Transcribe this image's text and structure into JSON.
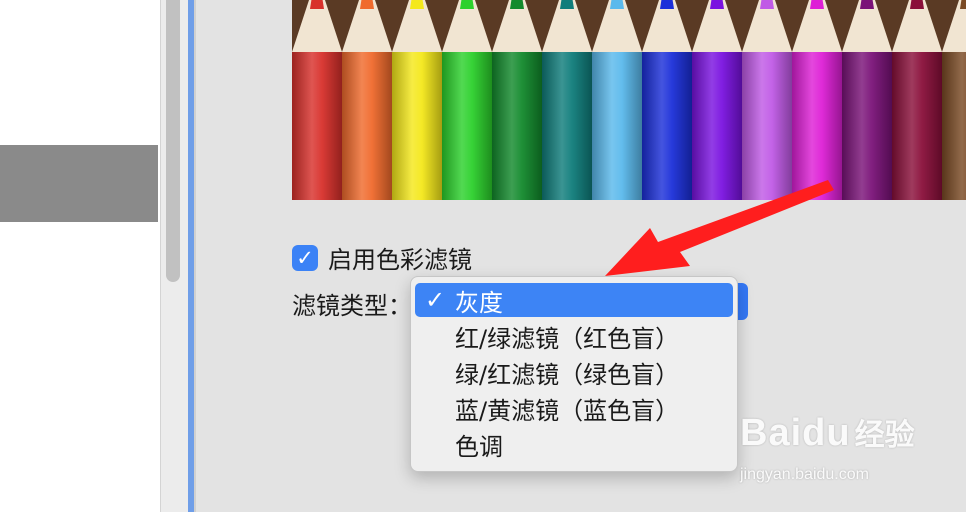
{
  "pencils": [
    {
      "color": "#d8302b"
    },
    {
      "color": "#f06a2c"
    },
    {
      "color": "#f4e81a"
    },
    {
      "color": "#2cd12c"
    },
    {
      "color": "#128a2c"
    },
    {
      "color": "#0f7d7b"
    },
    {
      "color": "#5ab9ec"
    },
    {
      "color": "#1b2fd9"
    },
    {
      "color": "#7a12e0"
    },
    {
      "color": "#c05ae6"
    },
    {
      "color": "#de1fd6"
    },
    {
      "color": "#7a1278"
    },
    {
      "color": "#8a0f3a"
    },
    {
      "color": "#7a4a24"
    }
  ],
  "filter": {
    "enable_label": "启用色彩滤镜",
    "enabled": true,
    "type_label": "滤镜类型：",
    "options": [
      {
        "label": "灰度",
        "selected": true,
        "check": "✓"
      },
      {
        "label": "红/绿滤镜（红色盲）",
        "selected": false
      },
      {
        "label": "绿/红滤镜（绿色盲）",
        "selected": false
      },
      {
        "label": "蓝/黄滤镜（蓝色盲）",
        "selected": false
      },
      {
        "label": "色调",
        "selected": false
      }
    ]
  },
  "watermark": {
    "brand": "Bai",
    "paw": "du",
    "cn": "经验",
    "url": "jingyan.baidu.com"
  },
  "colors": {
    "accent": "#3d84f5",
    "annotation_arrow": "#ff1e1e"
  }
}
